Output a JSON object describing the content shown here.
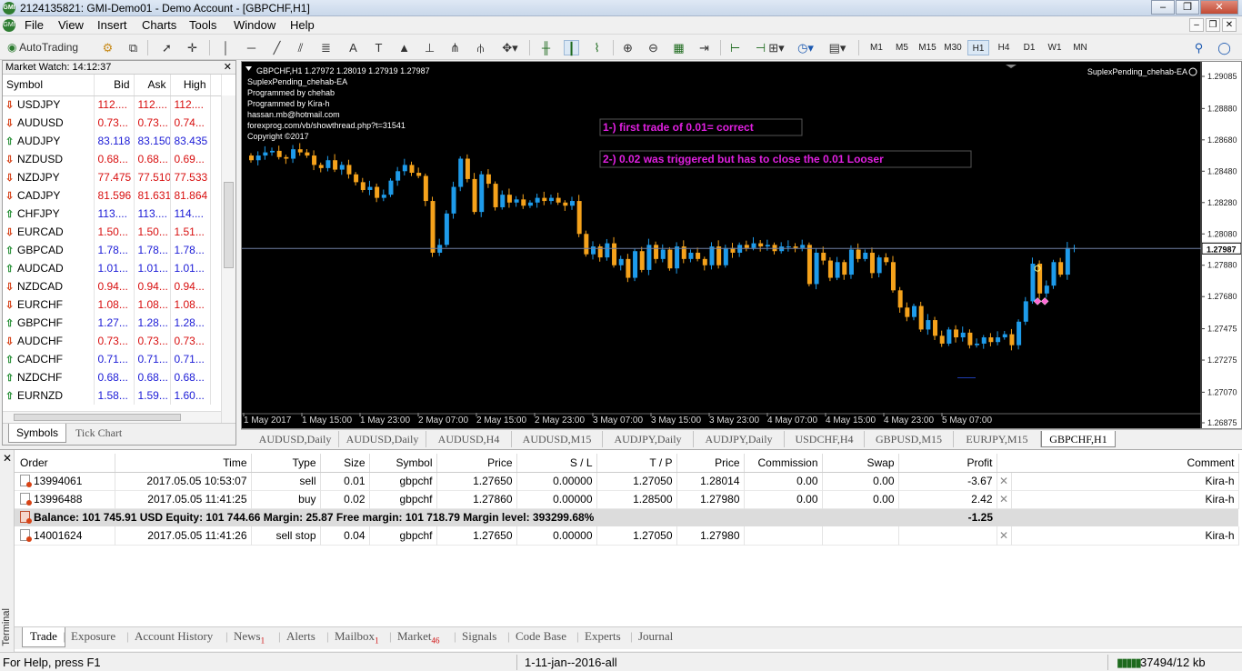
{
  "window": {
    "title": "2124135821: GMI-Demo01 - Demo Account - [GBPCHF,H1]",
    "icon": "mt4-logo-icon"
  },
  "menu": [
    "File",
    "View",
    "Insert",
    "Charts",
    "Tools",
    "Window",
    "Help"
  ],
  "toolbar": {
    "autotrading": "AutoTrading",
    "timeframes": [
      "M1",
      "M5",
      "M15",
      "M30",
      "H1",
      "H4",
      "D1",
      "W1",
      "MN"
    ],
    "selected_timeframe": "H1"
  },
  "market_watch": {
    "title": "Market Watch: 14:12:37",
    "columns": [
      "Symbol",
      "Bid",
      "Ask",
      "High"
    ],
    "rows": [
      {
        "symbol": "USDJPY",
        "dir": "down",
        "bid": "112....",
        "ask": "112....",
        "high": "112....",
        "color": "red"
      },
      {
        "symbol": "AUDUSD",
        "dir": "down",
        "bid": "0.73...",
        "ask": "0.73...",
        "high": "0.74...",
        "color": "red"
      },
      {
        "symbol": "AUDJPY",
        "dir": "up",
        "bid": "83.118",
        "ask": "83.150",
        "high": "83.435",
        "color": "blue"
      },
      {
        "symbol": "NZDUSD",
        "dir": "down",
        "bid": "0.68...",
        "ask": "0.68...",
        "high": "0.69...",
        "color": "red"
      },
      {
        "symbol": "NZDJPY",
        "dir": "down",
        "bid": "77.475",
        "ask": "77.510",
        "high": "77.533",
        "color": "red"
      },
      {
        "symbol": "CADJPY",
        "dir": "down",
        "bid": "81.596",
        "ask": "81.631",
        "high": "81.864",
        "color": "red"
      },
      {
        "symbol": "CHFJPY",
        "dir": "up",
        "bid": "113....",
        "ask": "113....",
        "high": "114....",
        "color": "blue"
      },
      {
        "symbol": "EURCAD",
        "dir": "down",
        "bid": "1.50...",
        "ask": "1.50...",
        "high": "1.51...",
        "color": "red"
      },
      {
        "symbol": "GBPCAD",
        "dir": "up",
        "bid": "1.78...",
        "ask": "1.78...",
        "high": "1.78...",
        "color": "blue"
      },
      {
        "symbol": "AUDCAD",
        "dir": "up",
        "bid": "1.01...",
        "ask": "1.01...",
        "high": "1.01...",
        "color": "blue"
      },
      {
        "symbol": "NZDCAD",
        "dir": "down",
        "bid": "0.94...",
        "ask": "0.94...",
        "high": "0.94...",
        "color": "red"
      },
      {
        "symbol": "EURCHF",
        "dir": "down",
        "bid": "1.08...",
        "ask": "1.08...",
        "high": "1.08...",
        "color": "red"
      },
      {
        "symbol": "GBPCHF",
        "dir": "up",
        "bid": "1.27...",
        "ask": "1.28...",
        "high": "1.28...",
        "color": "blue"
      },
      {
        "symbol": "AUDCHF",
        "dir": "down",
        "bid": "0.73...",
        "ask": "0.73...",
        "high": "0.73...",
        "color": "red"
      },
      {
        "symbol": "CADCHF",
        "dir": "up",
        "bid": "0.71...",
        "ask": "0.71...",
        "high": "0.71...",
        "color": "blue"
      },
      {
        "symbol": "NZDCHF",
        "dir": "up",
        "bid": "0.68...",
        "ask": "0.68...",
        "high": "0.68...",
        "color": "blue"
      },
      {
        "symbol": "EURNZD",
        "dir": "up",
        "bid": "1.58...",
        "ask": "1.59...",
        "high": "1.60...",
        "color": "blue"
      }
    ],
    "tabs": [
      "Symbols",
      "Tick Chart"
    ]
  },
  "chart": {
    "header": "GBPCHF,H1  1.27972 1.28019 1.27919 1.27987",
    "ea_name": "SuplexPending_chehab-EA",
    "info_lines": [
      "SuplexPending_chehab-EA",
      "Programmed by chehab",
      "Programmed by Kira-h",
      "hassan.mb@hotmail.com",
      "forexprog.com/vb/showthread.php?t=31541",
      "Copyright ©2017"
    ],
    "annotations": [
      "1-)   first trade of 0.01= correct",
      "2-)   0.02 was triggered but has to close the 0.01  Looser"
    ],
    "current_price": "1.27987",
    "colors": {
      "bull": "#1e9bea",
      "bear": "#f5a21b",
      "annotation": "#e020e0",
      "bg": "#000000"
    }
  },
  "chart_data": {
    "type": "candlestick",
    "symbol": "GBPCHF",
    "timeframe": "H1",
    "x_tick_labels": [
      "1 May 2017",
      "1 May 15:00",
      "1 May 23:00",
      "2 May 07:00",
      "2 May 15:00",
      "2 May 23:00",
      "3 May 07:00",
      "3 May 15:00",
      "3 May 23:00",
      "4 May 07:00",
      "4 May 15:00",
      "4 May 23:00",
      "5 May 07:00"
    ],
    "y_tick_labels": [
      "1.29085",
      "1.28880",
      "1.28680",
      "1.28480",
      "1.28280",
      "1.28080",
      "1.27880",
      "1.27680",
      "1.27475",
      "1.27275",
      "1.27070",
      "1.26875"
    ],
    "ylim": [
      1.26875,
      1.29085
    ],
    "current_price": 1.27987,
    "closes": [
      1.2855,
      1.2858,
      1.286,
      1.2861,
      1.2857,
      1.2856,
      1.2862,
      1.286,
      1.2858,
      1.2852,
      1.285,
      1.2855,
      1.2849,
      1.2852,
      1.2846,
      1.2841,
      1.2836,
      1.2838,
      1.2831,
      1.2833,
      1.2842,
      1.2848,
      1.2852,
      1.2847,
      1.2845,
      1.2829,
      1.2796,
      1.2801,
      1.2821,
      1.2838,
      1.2856,
      1.2843,
      1.2822,
      1.2846,
      1.284,
      1.2825,
      1.2833,
      1.2828,
      1.283,
      1.2826,
      1.2828,
      1.2831,
      1.2829,
      1.2831,
      1.2828,
      1.2826,
      1.2829,
      1.2808,
      1.2795,
      1.28,
      1.2793,
      1.2802,
      1.2788,
      1.2792,
      1.278,
      1.2797,
      1.2785,
      1.2801,
      1.2792,
      1.2798,
      1.2786,
      1.28,
      1.2792,
      1.2796,
      1.2792,
      1.2788,
      1.28,
      1.2788,
      1.2799,
      1.2796,
      1.2801,
      1.2799,
      1.2802,
      1.28,
      1.2801,
      1.2797,
      1.28,
      1.28,
      1.2799,
      1.2801,
      1.2776,
      1.2796,
      1.2791,
      1.278,
      1.279,
      1.2782,
      1.2798,
      1.2792,
      1.2796,
      1.2783,
      1.2793,
      1.279,
      1.2772,
      1.2761,
      1.2755,
      1.2762,
      1.2747,
      1.2753,
      1.2743,
      1.2738,
      1.2747,
      1.2742,
      1.2745,
      1.2737,
      1.2738,
      1.2742,
      1.2739,
      1.2742,
      1.2744,
      1.2737,
      1.2752,
      1.2765,
      1.2789,
      1.277,
      1.2775,
      1.279,
      1.2782,
      1.2799,
      1.2799
    ]
  },
  "chart_tabs": [
    "AUDUSD,Daily",
    "AUDUSD,Daily",
    "AUDUSD,H4",
    "AUDUSD,M15",
    "AUDJPY,Daily",
    "AUDJPY,Daily",
    "USDCHF,H4",
    "GBPUSD,M15",
    "EURJPY,M15",
    "GBPCHF,H1"
  ],
  "terminal": {
    "label": "Terminal",
    "columns": [
      "Order",
      "Time",
      "Type",
      "Size",
      "Symbol",
      "Price",
      "S / L",
      "T / P",
      "Price",
      "Commission",
      "Swap",
      "Profit",
      "Comment"
    ],
    "orders": [
      {
        "order": "13994061",
        "time": "2017.05.05 10:53:07",
        "type": "sell",
        "size": "0.01",
        "symbol": "gbpchf",
        "price": "1.27650",
        "sl": "0.00000",
        "tp": "1.27050",
        "cur": "1.28014",
        "commission": "0.00",
        "swap": "0.00",
        "profit": "-3.67",
        "comment": "Kira-h"
      },
      {
        "order": "13996488",
        "time": "2017.05.05 11:41:25",
        "type": "buy",
        "size": "0.02",
        "symbol": "gbpchf",
        "price": "1.27860",
        "sl": "0.00000",
        "tp": "1.28500",
        "cur": "1.27980",
        "commission": "0.00",
        "swap": "0.00",
        "profit": "2.42",
        "comment": "Kira-h"
      }
    ],
    "balance_line": "Balance: 101 745.91 USD  Equity: 101 744.66  Margin: 25.87  Free margin: 101 718.79  Margin level: 393299.68%",
    "total_profit": "-1.25",
    "pending": {
      "order": "14001624",
      "time": "2017.05.05 11:41:26",
      "type": "sell stop",
      "size": "0.04",
      "symbol": "gbpchf",
      "price": "1.27650",
      "sl": "0.00000",
      "tp": "1.27050",
      "cur": "1.27980",
      "comment": "Kira-h"
    },
    "tabs": [
      {
        "label": "Trade"
      },
      {
        "label": "Exposure"
      },
      {
        "label": "Account History"
      },
      {
        "label": "News",
        "badge": "1"
      },
      {
        "label": "Alerts"
      },
      {
        "label": "Mailbox",
        "badge": "1"
      },
      {
        "label": "Market",
        "badge": "46"
      },
      {
        "label": "Signals"
      },
      {
        "label": "Code Base"
      },
      {
        "label": "Experts"
      },
      {
        "label": "Journal"
      }
    ]
  },
  "status": {
    "help": "For Help, press F1",
    "profile": "1-11-jan--2016-all",
    "traffic": "37494/12 kb"
  }
}
